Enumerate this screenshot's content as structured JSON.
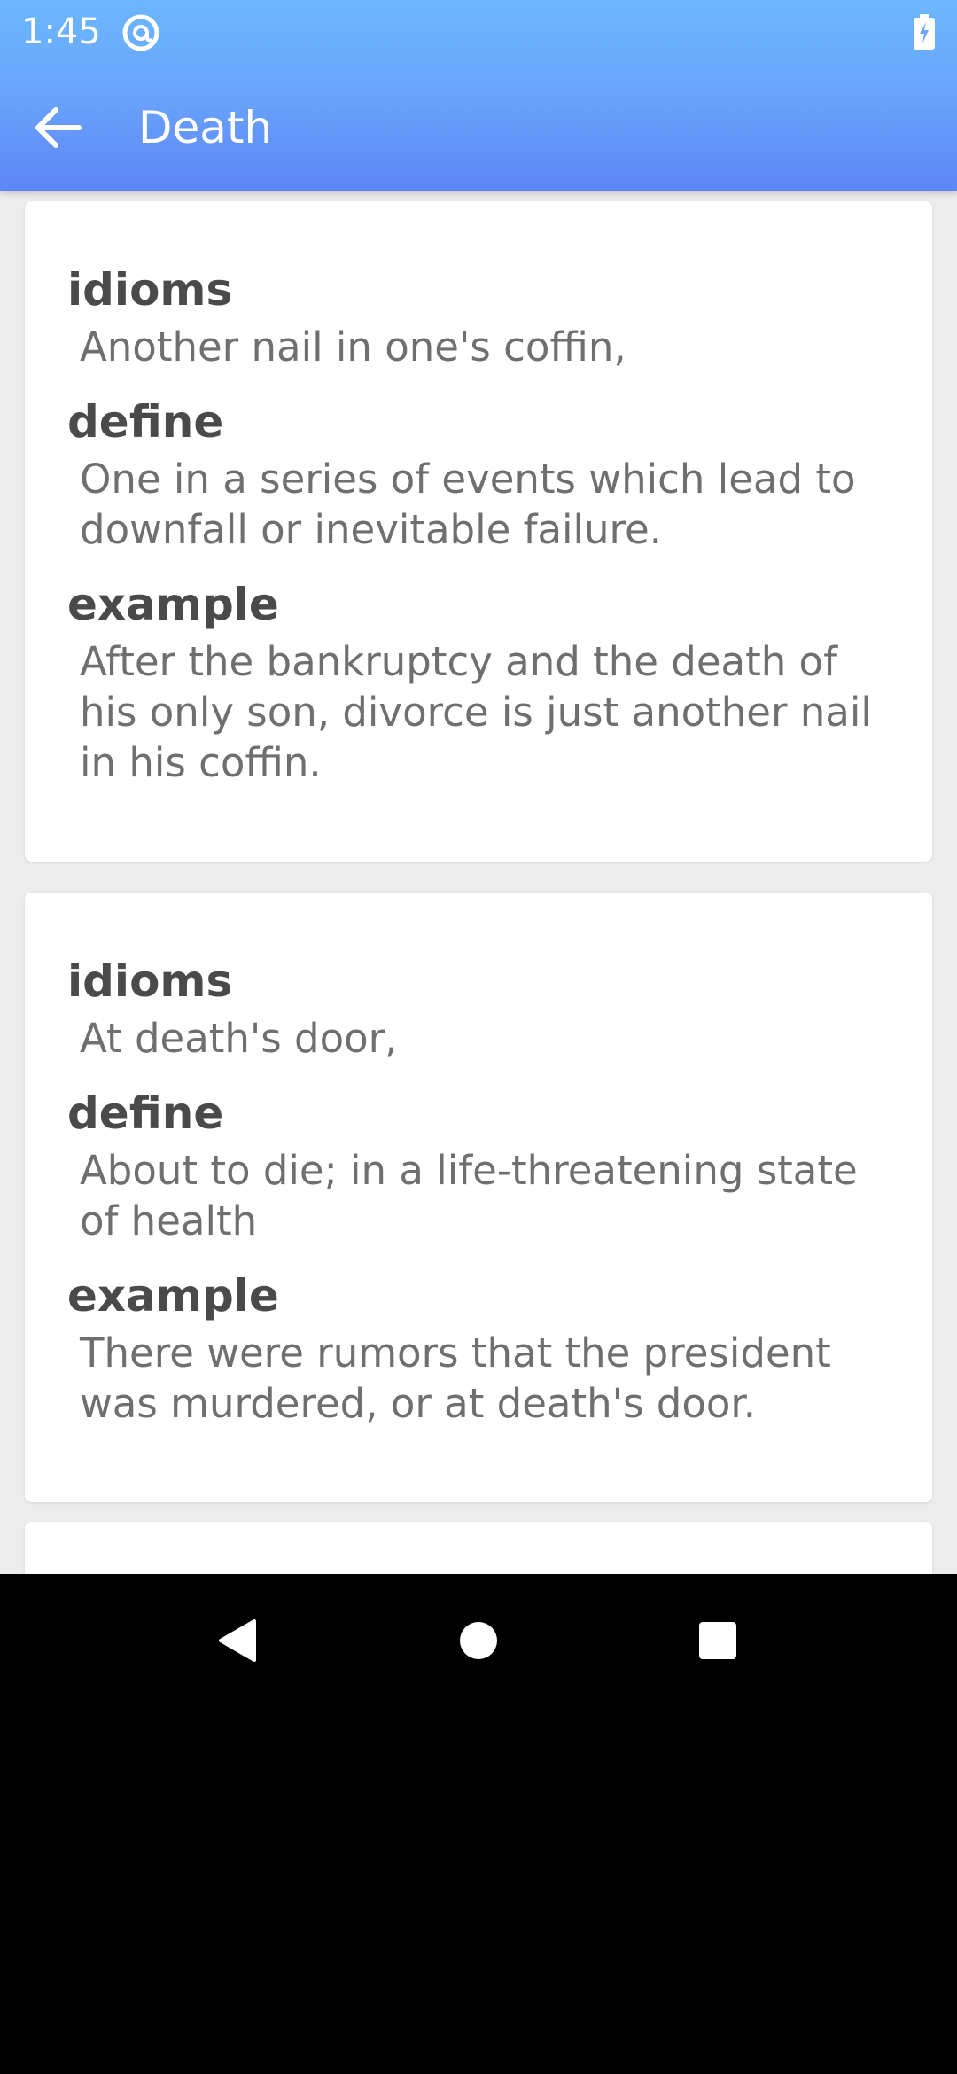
{
  "status_bar": {
    "time": "1:45",
    "app_icon": "at-sign-icon",
    "battery_icon": "battery-charging-icon"
  },
  "toolbar": {
    "back_icon": "arrow-back-icon",
    "title": "Death"
  },
  "cards": [
    {
      "idioms_label": "idioms",
      "idioms_value": "Another nail in one's coffin,",
      "define_label": "define",
      "define_value": "One in a series of events which lead to\ndownfall or inevitable failure.",
      "example_label": "example",
      "example_value": "After the bankruptcy and the death of\nhis only son, divorce is just another nail\nin his coffin."
    },
    {
      "idioms_label": "idioms",
      "idioms_value": "At death's door,",
      "define_label": "define",
      "define_value": "About to die; in a life-threatening state\nof health",
      "example_label": "example",
      "example_value": "There were rumors that the president\nwas murdered, or at death's door."
    }
  ],
  "navigation_bar": {
    "back": "triangle-back-icon",
    "home": "circle-home-icon",
    "recents": "square-recents-icon"
  },
  "colors": {
    "appbar_top": "#6bb7fd",
    "appbar_bottom": "#5d86f6",
    "background": "#ececec",
    "label_text": "#4a4a4a",
    "value_text": "#6f6f6f"
  }
}
